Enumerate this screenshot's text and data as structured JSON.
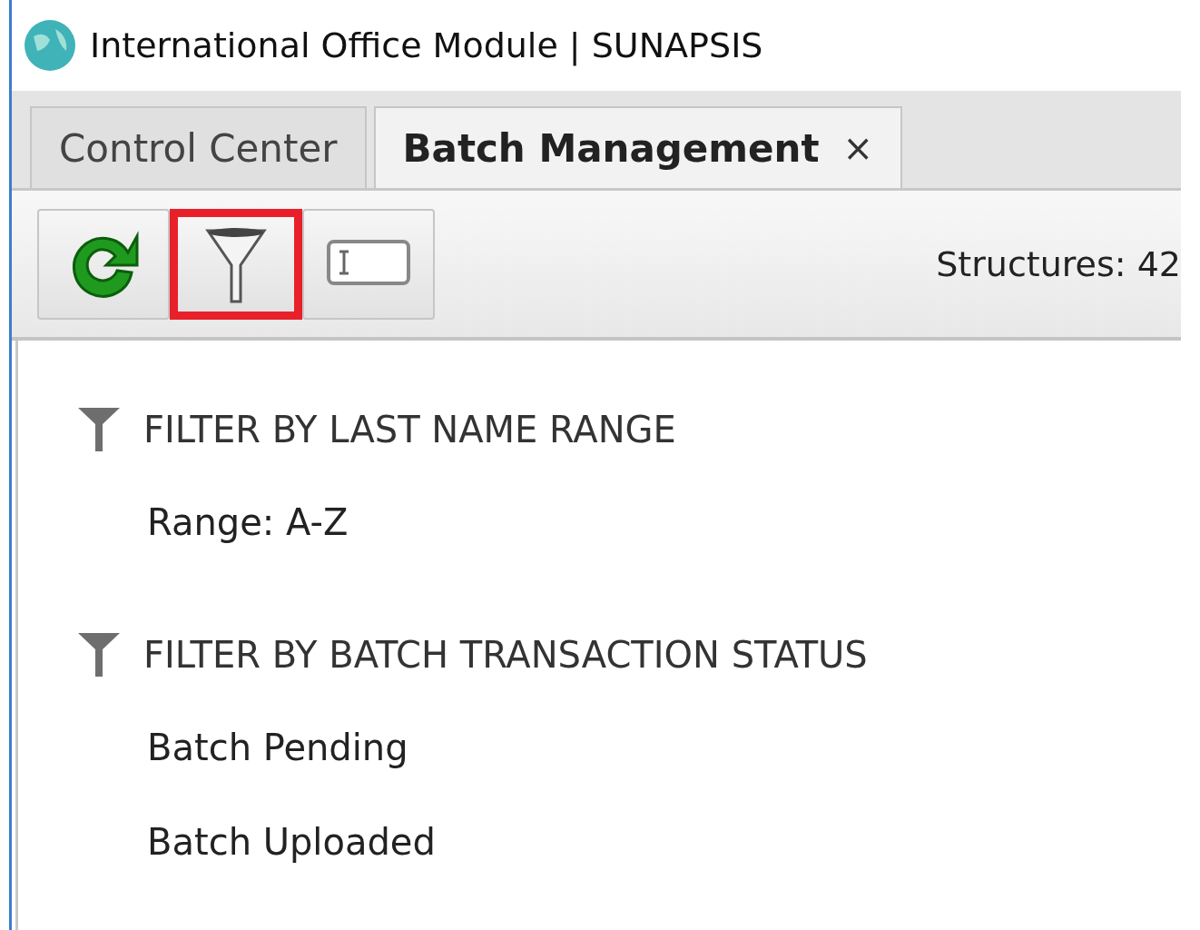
{
  "window": {
    "title": "International Office Module | SUNAPSIS"
  },
  "tabs": [
    {
      "label": "Control Center",
      "selected": false
    },
    {
      "label": "Batch Management",
      "selected": true,
      "close": "×"
    }
  ],
  "toolbar": {
    "buttons": [
      {
        "kind": "refresh",
        "highlighted": false
      },
      {
        "kind": "filter",
        "highlighted": true
      },
      {
        "kind": "textfield",
        "highlighted": false
      }
    ],
    "status": "Structures: 42"
  },
  "filters": [
    {
      "title": "FILTER BY LAST NAME RANGE",
      "items": [
        "Range: A-Z"
      ]
    },
    {
      "title": "FILTER BY BATCH TRANSACTION STATUS",
      "items": [
        "Batch Pending",
        "Batch Uploaded"
      ]
    }
  ]
}
